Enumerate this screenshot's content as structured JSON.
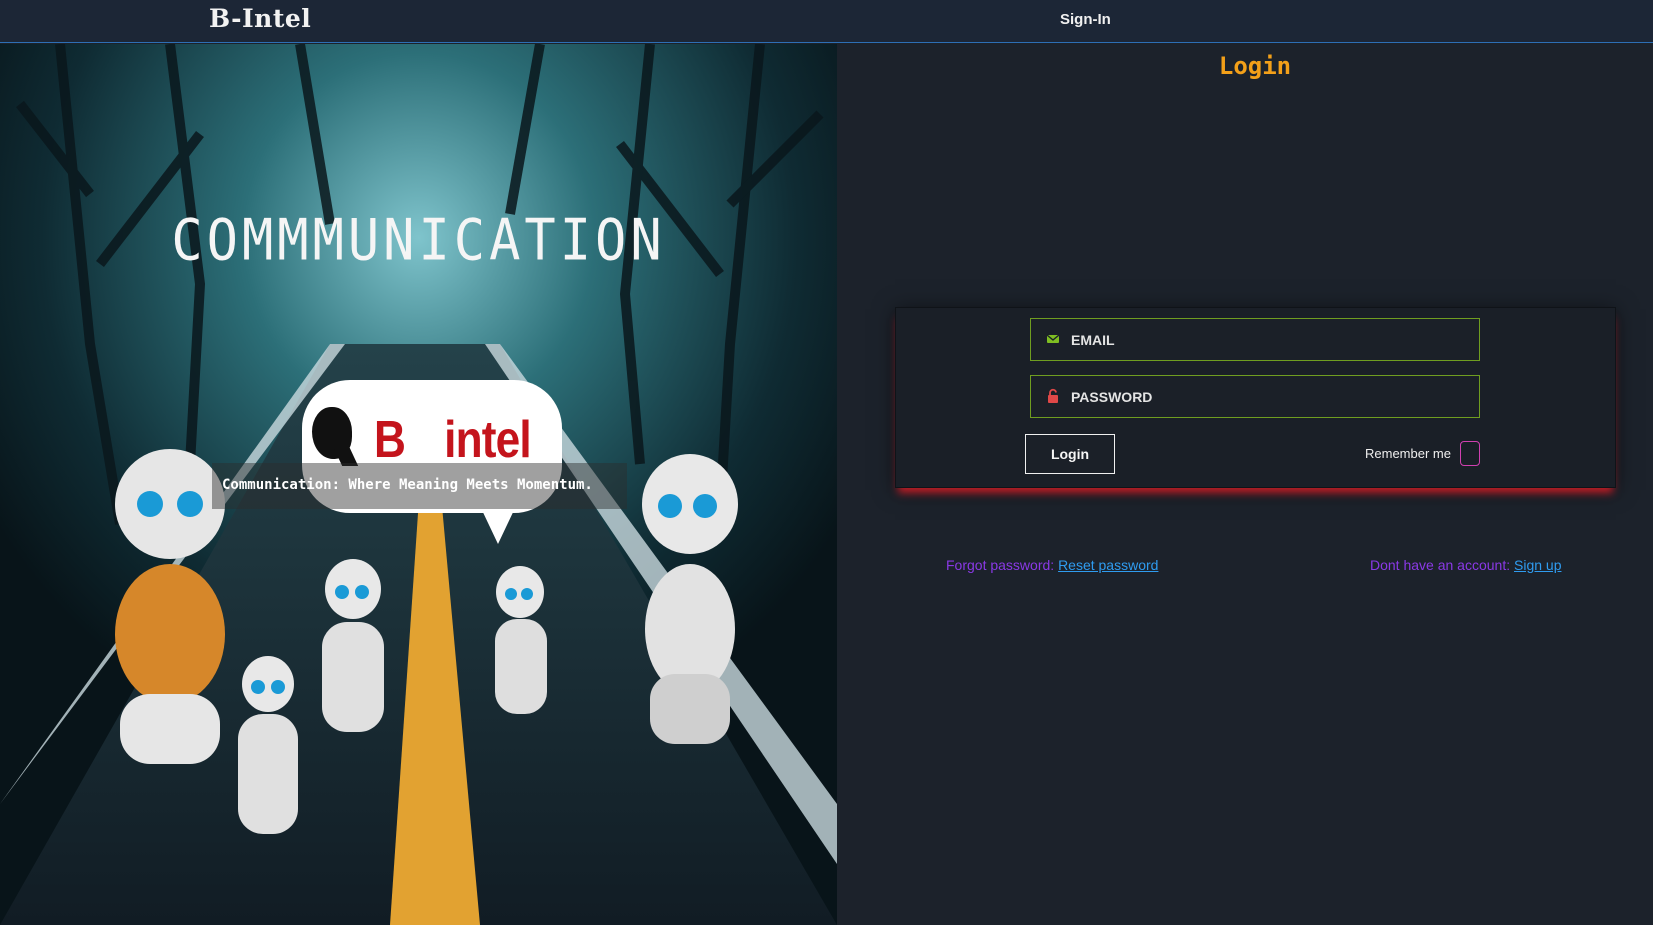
{
  "navbar": {
    "brand": "B-Intel",
    "links": [
      {
        "label": "Sign-In"
      }
    ]
  },
  "hero": {
    "title": "COMMMUNICATION",
    "logo_letter_left": "B",
    "logo_letter_right": "intel",
    "caption": "Communication: Where Meaning Meets Momentum."
  },
  "login": {
    "title": "Login",
    "email_placeholder": "EMAIL",
    "password_placeholder": "PASSWORD",
    "submit_label": "Login",
    "remember_label": "Remember me",
    "forgot_prefix": "Forgot password:",
    "forgot_link": "Reset password",
    "signup_prefix": "Dont have an account:",
    "signup_link": "Sign up"
  },
  "colors": {
    "accent_title": "#f3a019",
    "field_border": "#6f9d20",
    "card_glow": "#dc1e28",
    "link": "#2f9cf0",
    "link_prefix": "#8a39e6",
    "checkbox_border": "#d040b0"
  },
  "icons": {
    "email": "envelope-icon",
    "password": "unlock-icon"
  }
}
